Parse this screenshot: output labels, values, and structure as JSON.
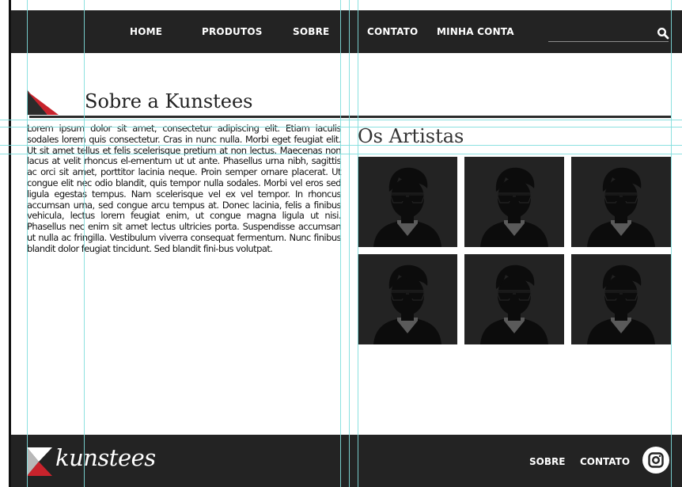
{
  "header": {
    "nav": [
      {
        "label": "HOME",
        "name": "nav-home"
      },
      {
        "label": "PRODUTOS",
        "name": "nav-produtos"
      },
      {
        "label": "SOBRE",
        "name": "nav-sobre"
      },
      {
        "label": "CONTATO",
        "name": "nav-contato"
      },
      {
        "label": "MINHA CONTA",
        "name": "nav-minha-conta"
      }
    ],
    "search_icon": "search-icon"
  },
  "about": {
    "title": "Sobre a Kunstees",
    "body": "Lorem ipsum dolor sit amet, consectetur adipiscing elit. Etiam iaculis sodales lorem quis consectetur. Cras in nunc nulla. Morbi eget feugiat elit. Ut sit amet tellus et felis scelerisque pretium at non lectus. Maecenas non lacus at velit rhoncus el-ementum ut ut ante. Phasellus urna nibh, sagittis ac orci sit amet, porttitor lacinia neque. Proin semper ornare placerat. Ut congue elit nec odio blandit, quis tempor nulla sodales. Morbi vel eros sed ligula egestas tempus. Nam scelerisque vel ex vel tempor. In rhoncus accumsan urna, sed congue arcu tempus at. Donec lacinia, felis a finibus vehicula, lectus lorem feugiat enim, ut congue magna ligula ut nisi. Phasellus nec enim sit amet lectus ultricies porta. Suspendisse accumsan ut nulla ac fringilla. Vestibulum viverra consequat fermentum. Nunc finibus blandit dolor feugiat tincidunt. Sed blandit fini-bus volutpat."
  },
  "artists": {
    "title": "Os Artistas",
    "count": 6,
    "icon": "artist-avatar-icon"
  },
  "footer": {
    "logo_text": "kunstees",
    "links": [
      {
        "label": "SOBRE",
        "name": "footer-sobre"
      },
      {
        "label": "CONTATO",
        "name": "footer-contato"
      }
    ],
    "social_icon": "instagram-icon"
  },
  "colors": {
    "dark": "#232323",
    "accent_red": "#c8232c",
    "guide": "#7fdedd"
  }
}
